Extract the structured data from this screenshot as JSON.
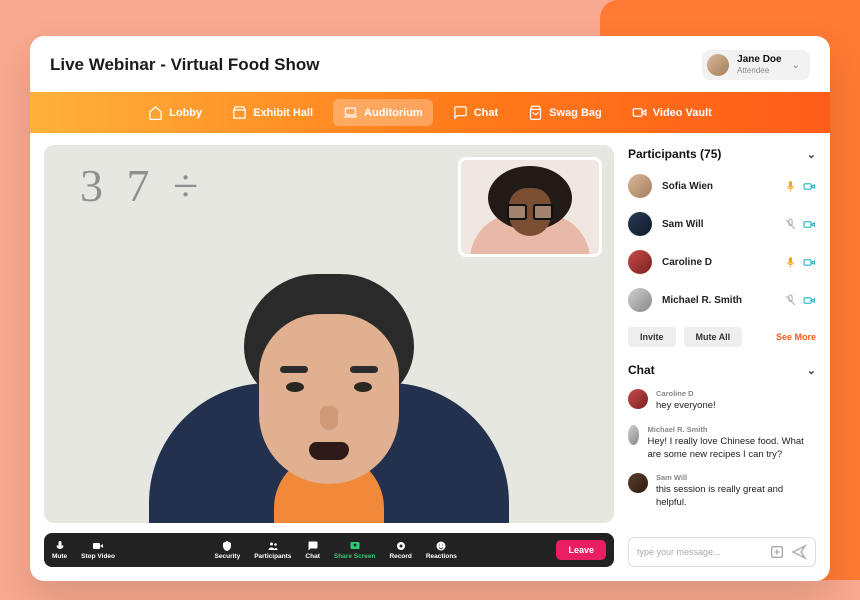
{
  "header": {
    "title": "Live Webinar - Virtual Food Show",
    "user": {
      "name": "Jane Doe",
      "role": "Attendee"
    }
  },
  "nav": {
    "items": [
      {
        "label": "Lobby",
        "icon": "home-icon"
      },
      {
        "label": "Exhibit Hall",
        "icon": "storefront-icon"
      },
      {
        "label": "Auditorium",
        "icon": "laptop-icon",
        "active": true
      },
      {
        "label": "Chat",
        "icon": "chat-icon"
      },
      {
        "label": "Swag Bag",
        "icon": "bag-icon"
      },
      {
        "label": "Video Vault",
        "icon": "video-icon"
      }
    ]
  },
  "controls": {
    "left": [
      {
        "label": "Mute",
        "icon": "mic-icon"
      },
      {
        "label": "Stop Video",
        "icon": "video-icon"
      }
    ],
    "center": [
      {
        "label": "Security",
        "icon": "shield-icon"
      },
      {
        "label": "Participants",
        "icon": "people-icon"
      },
      {
        "label": "Chat",
        "icon": "chat-icon"
      },
      {
        "label": "Share Screen",
        "icon": "share-icon",
        "accent": true
      },
      {
        "label": "Record",
        "icon": "record-icon"
      },
      {
        "label": "Reactions",
        "icon": "smile-icon"
      }
    ],
    "leave": "Leave"
  },
  "participants": {
    "title": "Participants (75)",
    "list": [
      {
        "name": "Sofia Wien",
        "mic": "on",
        "cam": "on",
        "avatar": "av1"
      },
      {
        "name": "Sam Will",
        "mic": "off",
        "cam": "on",
        "avatar": "av2"
      },
      {
        "name": "Caroline D",
        "mic": "on",
        "cam": "on",
        "avatar": "av3"
      },
      {
        "name": "Michael R. Smith",
        "mic": "off",
        "cam": "on",
        "avatar": "av4"
      }
    ],
    "invite": "Invite",
    "mute_all": "Mute All",
    "see_more": "See More"
  },
  "chat": {
    "title": "Chat",
    "messages": [
      {
        "name": "Caroline D",
        "body": "hey everyone!",
        "avatar": "av3"
      },
      {
        "name": "Michael R. Smith",
        "body": "Hey! I really love Chinese food. What are some new recipes I can try?",
        "avatar": "av4"
      },
      {
        "name": "Sam Will",
        "body": "this session is really great and helpful.",
        "avatar": "av5"
      }
    ],
    "placeholder": "type your message..."
  },
  "whiteboard": "3 7 ÷"
}
